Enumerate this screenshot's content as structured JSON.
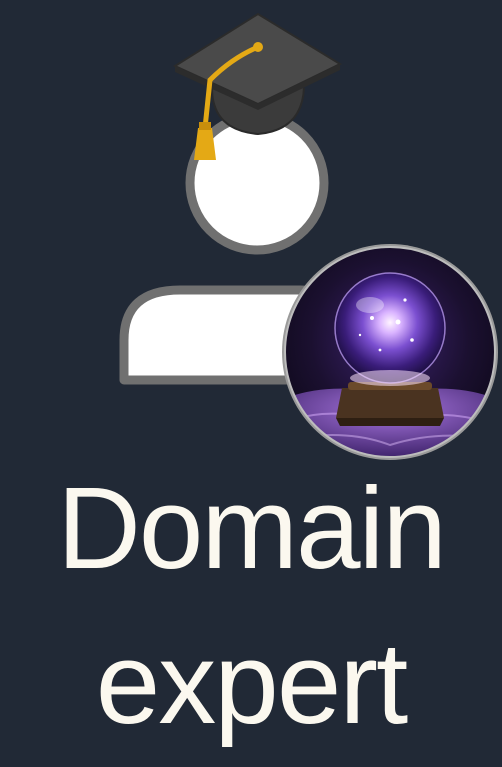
{
  "caption": {
    "line1": "Domain",
    "line2": "expert"
  },
  "icons": {
    "person": "person-icon",
    "cap": "graduation-cap-icon",
    "orb": "crystal-ball-icon"
  },
  "colors": {
    "background": "#212936",
    "text": "#fbf8ef",
    "person_fill": "#ffffff",
    "person_outline": "#707070",
    "cap": "#3a3a3a",
    "tassel": "#e4a915",
    "orb_glow": "#8e5bd6"
  }
}
